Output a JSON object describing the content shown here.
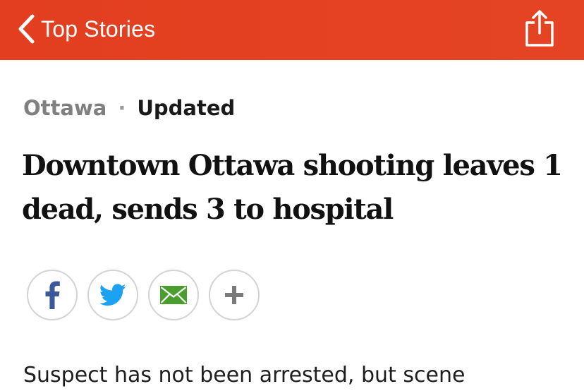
{
  "nav": {
    "back_label": "Top Stories",
    "background_color": "#e2411f",
    "share_icon": "share-icon"
  },
  "article": {
    "location": "Ottawa",
    "separator": "·",
    "status": "Updated",
    "headline": "Downtown Ottawa shooting leaves 1 dead, sends 3 to hospital",
    "summary": "Suspect has not been arrested, but scene"
  },
  "share_buttons": [
    {
      "icon": "facebook-icon",
      "color": "#3b5998"
    },
    {
      "icon": "twitter-icon",
      "color": "#1da1f2"
    },
    {
      "icon": "email-icon",
      "color": "#4a9e2e"
    },
    {
      "icon": "plus-icon",
      "color": "#7a7a7a"
    }
  ]
}
